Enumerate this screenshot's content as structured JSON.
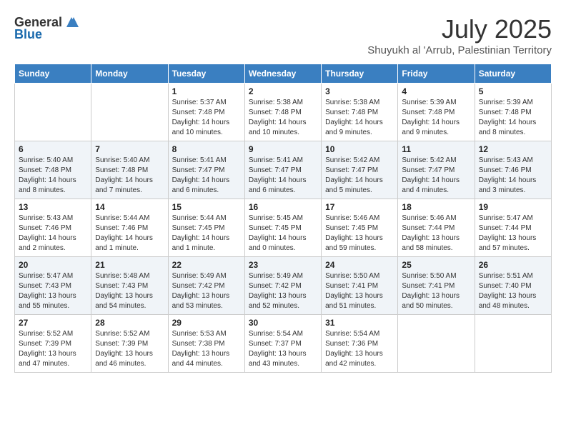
{
  "header": {
    "logo_general": "General",
    "logo_blue": "Blue",
    "month": "July 2025",
    "location": "Shuyukh al 'Arrub, Palestinian Territory"
  },
  "weekdays": [
    "Sunday",
    "Monday",
    "Tuesday",
    "Wednesday",
    "Thursday",
    "Friday",
    "Saturday"
  ],
  "weeks": [
    [
      {
        "day": "",
        "info": ""
      },
      {
        "day": "",
        "info": ""
      },
      {
        "day": "1",
        "info": "Sunrise: 5:37 AM\nSunset: 7:48 PM\nDaylight: 14 hours and 10 minutes."
      },
      {
        "day": "2",
        "info": "Sunrise: 5:38 AM\nSunset: 7:48 PM\nDaylight: 14 hours and 10 minutes."
      },
      {
        "day": "3",
        "info": "Sunrise: 5:38 AM\nSunset: 7:48 PM\nDaylight: 14 hours and 9 minutes."
      },
      {
        "day": "4",
        "info": "Sunrise: 5:39 AM\nSunset: 7:48 PM\nDaylight: 14 hours and 9 minutes."
      },
      {
        "day": "5",
        "info": "Sunrise: 5:39 AM\nSunset: 7:48 PM\nDaylight: 14 hours and 8 minutes."
      }
    ],
    [
      {
        "day": "6",
        "info": "Sunrise: 5:40 AM\nSunset: 7:48 PM\nDaylight: 14 hours and 8 minutes."
      },
      {
        "day": "7",
        "info": "Sunrise: 5:40 AM\nSunset: 7:48 PM\nDaylight: 14 hours and 7 minutes."
      },
      {
        "day": "8",
        "info": "Sunrise: 5:41 AM\nSunset: 7:47 PM\nDaylight: 14 hours and 6 minutes."
      },
      {
        "day": "9",
        "info": "Sunrise: 5:41 AM\nSunset: 7:47 PM\nDaylight: 14 hours and 6 minutes."
      },
      {
        "day": "10",
        "info": "Sunrise: 5:42 AM\nSunset: 7:47 PM\nDaylight: 14 hours and 5 minutes."
      },
      {
        "day": "11",
        "info": "Sunrise: 5:42 AM\nSunset: 7:47 PM\nDaylight: 14 hours and 4 minutes."
      },
      {
        "day": "12",
        "info": "Sunrise: 5:43 AM\nSunset: 7:46 PM\nDaylight: 14 hours and 3 minutes."
      }
    ],
    [
      {
        "day": "13",
        "info": "Sunrise: 5:43 AM\nSunset: 7:46 PM\nDaylight: 14 hours and 2 minutes."
      },
      {
        "day": "14",
        "info": "Sunrise: 5:44 AM\nSunset: 7:46 PM\nDaylight: 14 hours and 1 minute."
      },
      {
        "day": "15",
        "info": "Sunrise: 5:44 AM\nSunset: 7:45 PM\nDaylight: 14 hours and 1 minute."
      },
      {
        "day": "16",
        "info": "Sunrise: 5:45 AM\nSunset: 7:45 PM\nDaylight: 14 hours and 0 minutes."
      },
      {
        "day": "17",
        "info": "Sunrise: 5:46 AM\nSunset: 7:45 PM\nDaylight: 13 hours and 59 minutes."
      },
      {
        "day": "18",
        "info": "Sunrise: 5:46 AM\nSunset: 7:44 PM\nDaylight: 13 hours and 58 minutes."
      },
      {
        "day": "19",
        "info": "Sunrise: 5:47 AM\nSunset: 7:44 PM\nDaylight: 13 hours and 57 minutes."
      }
    ],
    [
      {
        "day": "20",
        "info": "Sunrise: 5:47 AM\nSunset: 7:43 PM\nDaylight: 13 hours and 55 minutes."
      },
      {
        "day": "21",
        "info": "Sunrise: 5:48 AM\nSunset: 7:43 PM\nDaylight: 13 hours and 54 minutes."
      },
      {
        "day": "22",
        "info": "Sunrise: 5:49 AM\nSunset: 7:42 PM\nDaylight: 13 hours and 53 minutes."
      },
      {
        "day": "23",
        "info": "Sunrise: 5:49 AM\nSunset: 7:42 PM\nDaylight: 13 hours and 52 minutes."
      },
      {
        "day": "24",
        "info": "Sunrise: 5:50 AM\nSunset: 7:41 PM\nDaylight: 13 hours and 51 minutes."
      },
      {
        "day": "25",
        "info": "Sunrise: 5:50 AM\nSunset: 7:41 PM\nDaylight: 13 hours and 50 minutes."
      },
      {
        "day": "26",
        "info": "Sunrise: 5:51 AM\nSunset: 7:40 PM\nDaylight: 13 hours and 48 minutes."
      }
    ],
    [
      {
        "day": "27",
        "info": "Sunrise: 5:52 AM\nSunset: 7:39 PM\nDaylight: 13 hours and 47 minutes."
      },
      {
        "day": "28",
        "info": "Sunrise: 5:52 AM\nSunset: 7:39 PM\nDaylight: 13 hours and 46 minutes."
      },
      {
        "day": "29",
        "info": "Sunrise: 5:53 AM\nSunset: 7:38 PM\nDaylight: 13 hours and 44 minutes."
      },
      {
        "day": "30",
        "info": "Sunrise: 5:54 AM\nSunset: 7:37 PM\nDaylight: 13 hours and 43 minutes."
      },
      {
        "day": "31",
        "info": "Sunrise: 5:54 AM\nSunset: 7:36 PM\nDaylight: 13 hours and 42 minutes."
      },
      {
        "day": "",
        "info": ""
      },
      {
        "day": "",
        "info": ""
      }
    ]
  ]
}
